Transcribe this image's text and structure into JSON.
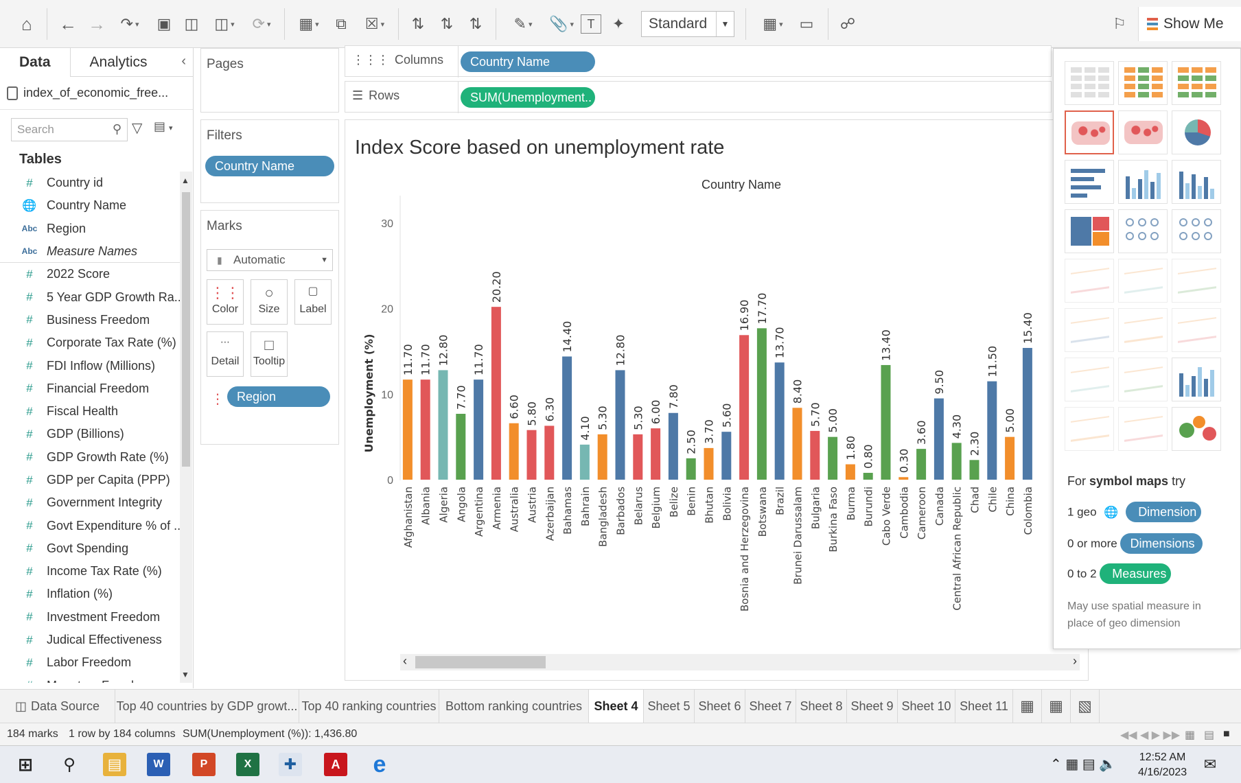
{
  "toolbar": {
    "presentation_mode": "Standard",
    "show_me_label": "Show Me"
  },
  "data_pane": {
    "tabs": [
      "Data",
      "Analytics"
    ],
    "datasource": "index_of_economic_free...",
    "search_placeholder": "Search",
    "tables_header": "Tables",
    "fields": [
      {
        "type": "#",
        "name": "Country id"
      },
      {
        "type": "globe",
        "name": "Country Name"
      },
      {
        "type": "Abc",
        "name": "Region"
      },
      {
        "type": "Abc",
        "name": "Measure Names"
      },
      {
        "type": "#",
        "name": "2022 Score"
      },
      {
        "type": "#",
        "name": "5 Year GDP Growth Ra..."
      },
      {
        "type": "#",
        "name": "Business Freedom"
      },
      {
        "type": "#",
        "name": "Corporate Tax Rate (%)"
      },
      {
        "type": "#",
        "name": "FDI Inflow (Millions)"
      },
      {
        "type": "#",
        "name": "Financial Freedom"
      },
      {
        "type": "#",
        "name": "Fiscal Health"
      },
      {
        "type": "#",
        "name": "GDP (Billions)"
      },
      {
        "type": "#",
        "name": "GDP Growth Rate (%)"
      },
      {
        "type": "#",
        "name": "GDP per Capita (PPP)"
      },
      {
        "type": "#",
        "name": "Government Integrity"
      },
      {
        "type": "#",
        "name": "Govt Expenditure % of ..."
      },
      {
        "type": "#",
        "name": "Govt Spending"
      },
      {
        "type": "#",
        "name": "Income Tax Rate (%)"
      },
      {
        "type": "#",
        "name": "Inflation (%)"
      },
      {
        "type": "#",
        "name": "Investment Freedom"
      },
      {
        "type": "#",
        "name": "Judical Effectiveness"
      },
      {
        "type": "#",
        "name": "Labor Freedom"
      },
      {
        "type": "#",
        "name": "Monetary Freedom"
      }
    ]
  },
  "cards": {
    "pages": "Pages",
    "filters": "Filters",
    "filter_pill": "Country Name",
    "marks": "Marks",
    "mark_type": "Automatic",
    "mark_buttons": [
      "Color",
      "Size",
      "Label",
      "Detail",
      "Tooltip"
    ],
    "color_pill": "Region"
  },
  "shelves": {
    "columns_label": "Columns",
    "columns_pill": "Country Name",
    "rows_label": "Rows",
    "rows_pill": "SUM(Unemployment.."
  },
  "view": {
    "title": "Index Score based on unemployment rate"
  },
  "chart_data": {
    "type": "bar",
    "title": "Index Score based on unemployment rate",
    "xlabel": "Country Name",
    "ylabel": "Unemployment (%)",
    "ylim": [
      0,
      30
    ],
    "yticks": [
      "0",
      "10",
      "20",
      "30"
    ],
    "colors": {
      "orange": "#f28e2b",
      "red": "#e15759",
      "teal": "#76b7b2",
      "green": "#59a14f",
      "blue": "#4e79a7"
    },
    "categories": [
      "Afghanistan",
      "Albania",
      "Algeria",
      "Angola",
      "Argentina",
      "Armenia",
      "Australia",
      "Austria",
      "Azerbaijan",
      "Bahamas",
      "Bahrain",
      "Bangladesh",
      "Barbados",
      "Belarus",
      "Belgium",
      "Belize",
      "Benin",
      "Bhutan",
      "Bolivia",
      "Bosnia and Herzegovina",
      "Botswana",
      "Brazil",
      "Brunei Darussalam",
      "Bulgaria",
      "Burkina Faso",
      "Burma",
      "Burundi",
      "Cabo Verde",
      "Cambodia",
      "Cameroon",
      "Canada",
      "Central African Republic",
      "Chad",
      "Chile",
      "China",
      "Colombia"
    ],
    "values": [
      11.7,
      11.7,
      12.8,
      7.7,
      11.7,
      20.2,
      6.6,
      5.8,
      6.3,
      14.4,
      4.1,
      5.3,
      12.8,
      5.3,
      6.0,
      7.8,
      2.5,
      3.7,
      5.6,
      16.9,
      17.7,
      13.7,
      8.4,
      5.7,
      5.0,
      1.8,
      0.8,
      13.4,
      0.3,
      3.6,
      9.5,
      4.3,
      2.3,
      11.5,
      5.0,
      15.4
    ],
    "labels": [
      "11.70",
      "11.70",
      "12.80",
      "7.70",
      "11.70",
      "20.20",
      "6.60",
      "5.80",
      "6.30",
      "14.40",
      "4.10",
      "5.30",
      "12.80",
      "5.30",
      "6.00",
      "7.80",
      "2.50",
      "3.70",
      "5.60",
      "16.90",
      "17.70",
      "13.70",
      "8.40",
      "5.70",
      "5.00",
      "1.80",
      "0.80",
      "13.40",
      "0.30",
      "3.60",
      "9.50",
      "4.30",
      "2.30",
      "11.50",
      "5.00",
      "15.40"
    ],
    "bar_colors": [
      "orange",
      "red",
      "teal",
      "green",
      "blue",
      "red",
      "orange",
      "red",
      "red",
      "blue",
      "teal",
      "orange",
      "blue",
      "red",
      "red",
      "blue",
      "green",
      "orange",
      "blue",
      "red",
      "green",
      "blue",
      "orange",
      "red",
      "green",
      "orange",
      "green",
      "green",
      "orange",
      "green",
      "blue",
      "green",
      "green",
      "blue",
      "orange",
      "blue"
    ]
  },
  "show_me": {
    "hint_title_pre": "For ",
    "hint_title_bold": "symbol maps",
    "hint_title_post": " try",
    "rows": [
      {
        "prefix": "1 geo",
        "pill": "Dimension"
      },
      {
        "prefix": "0 or more",
        "pill": "Dimensions"
      },
      {
        "prefix": "0 to 2",
        "pill": "Measures"
      }
    ],
    "note": "May use spatial measure in place of geo dimension"
  },
  "sheet_tabs": [
    "Data Source",
    "Top 40 countries by GDP growt...",
    "Top 40 ranking countries",
    "Bottom ranking countries",
    "Sheet 4",
    "Sheet 5",
    "Sheet 6",
    "Sheet 7",
    "Sheet 8",
    "Sheet 9",
    "Sheet 10",
    "Sheet 11"
  ],
  "active_sheet": "Sheet 4",
  "status": {
    "marks": "184 marks",
    "dims": "1 row by 184 columns",
    "sum": "SUM(Unemployment (%)): 1,436.80"
  },
  "taskbar": {
    "time": "12:52 AM",
    "date": "4/16/2023"
  }
}
